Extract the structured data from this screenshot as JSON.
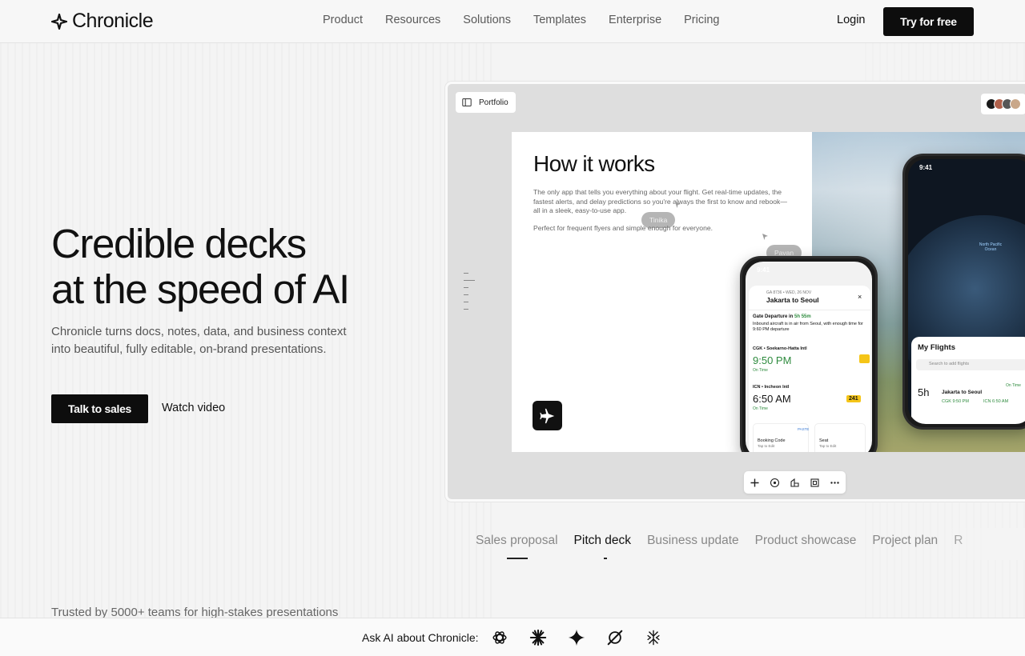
{
  "brand": {
    "name": "Chronicle"
  },
  "nav": {
    "links": [
      "Product",
      "Resources",
      "Solutions",
      "Templates",
      "Enterprise",
      "Pricing"
    ],
    "login": "Login",
    "cta": "Try for free"
  },
  "hero": {
    "title_line1": "Credible decks",
    "title_line2": "at the speed of AI",
    "subtitle": "Chronicle turns docs, notes, data, and business context into beautiful, fully editable, on-brand presentations.",
    "primary_cta": "Talk to sales",
    "secondary_cta": "Watch video"
  },
  "preview": {
    "folder": "Portfolio",
    "slide_title": "How it works",
    "slide_body": "The only app that tells you everything about your flight. Get real-time updates, the fastest alerts, and delay predictions so you're always the first to know and rebook—all in a sleek, easy-to-use app.",
    "slide_body2": "Perfect for frequent flyers and simple enough for everyone.",
    "cursor1": "Tinika",
    "cursor2": "Pavan",
    "phone": {
      "time": "9:41",
      "flight_code": "GA 8736 • WED, 26 NOV",
      "route": "Jakarta to Seoul",
      "gate_label": "Gate Departure in",
      "gate_time": "5h 55m",
      "gate_note": "Inbound aircraft is in air from Seoul, with enough time for 9:60 PM departure",
      "dep_airport": "CGK • Soekarno-Hatta Intl",
      "dep_time": "9:50 PM",
      "dep_status": "On Time",
      "arr_airport": "ICN • Incheon Intl",
      "arr_time": "6:50 AM",
      "arr_status": "On Time",
      "arr_badge": "241",
      "booking_label": "Booking Code",
      "booking_sub": "Tap to Edit",
      "paste": "PASTE",
      "seat_label": "Seat",
      "seat_sub": "Tap to Edit"
    },
    "phone2": {
      "time": "9:41",
      "ocean": "North Pacific Ocean",
      "my_flights": "My Flights",
      "search_placeholder": "Search to add flights",
      "eta": "5h",
      "route": "Jakarta to Seoul",
      "dep": "CGK 9:50 PM",
      "arr": "ICN 6:50 AM",
      "status": "On Time"
    }
  },
  "tabs": [
    "Sales proposal",
    "Pitch deck",
    "Business update",
    "Product showcase",
    "Project plan",
    "R"
  ],
  "active_tab": "Pitch deck",
  "trusted": "Trusted by 5000+ teams for high-stakes presentations",
  "ask_ai": {
    "label": "Ask AI about Chronicle:",
    "icons": [
      "openai-icon",
      "claude-icon",
      "gemini-icon",
      "perplexity-icon",
      "grok-icon"
    ]
  }
}
